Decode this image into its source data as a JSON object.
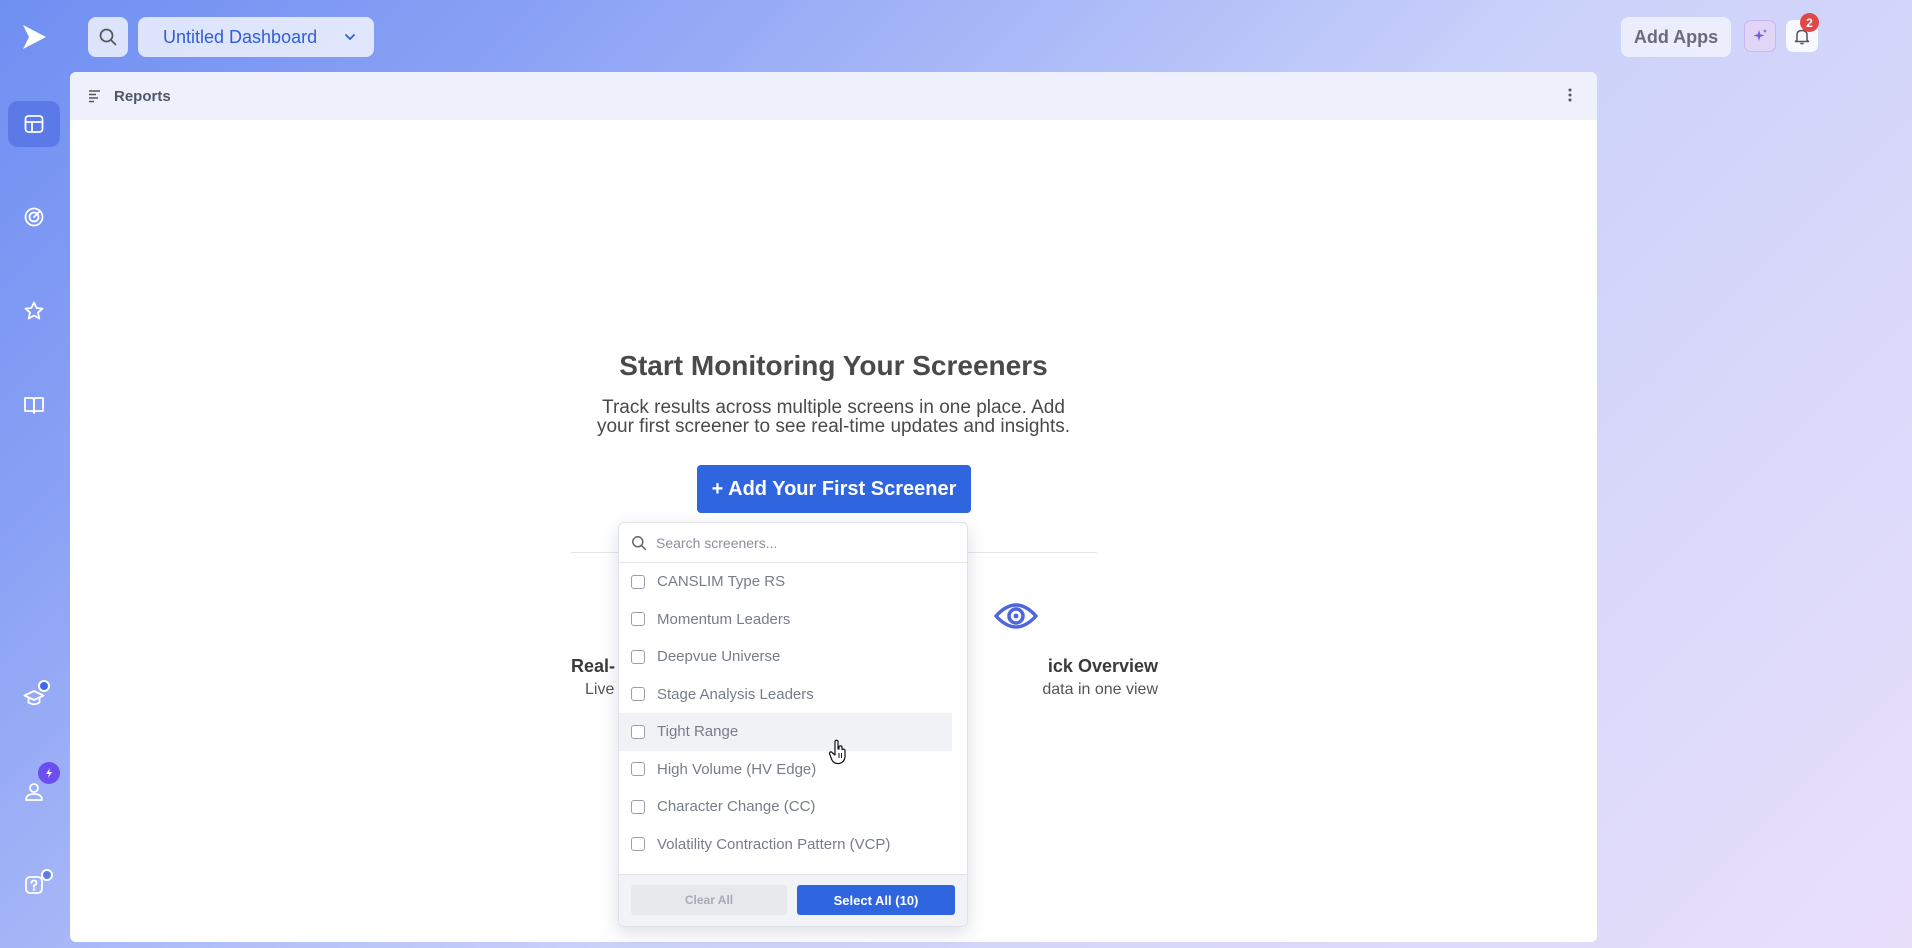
{
  "topbar": {
    "dashboard_name": "Untitled Dashboard",
    "add_apps_label": "Add Apps",
    "notification_count": "2"
  },
  "panel": {
    "title": "Reports"
  },
  "empty_state": {
    "title": "Start Monitoring Your Screeners",
    "description_line1": "Track results across multiple screens in one place. Add",
    "description_line2": "your first screener to see real-time updates and insights.",
    "button_label": "+ Add Your First Screener",
    "features": [
      {
        "title": "Real-",
        "description": "Live"
      },
      {
        "title": "ick Overview",
        "description": "data in one view"
      }
    ]
  },
  "dropdown": {
    "search_placeholder": "Search screeners...",
    "items": [
      {
        "label": "CANSLIM Type RS",
        "checked": false
      },
      {
        "label": "Momentum Leaders",
        "checked": false
      },
      {
        "label": "Deepvue Universe",
        "checked": false
      },
      {
        "label": "Stage Analysis Leaders",
        "checked": false
      },
      {
        "label": "Tight Range",
        "checked": false
      },
      {
        "label": "High Volume (HV Edge)",
        "checked": false
      },
      {
        "label": "Character Change (CC)",
        "checked": false
      },
      {
        "label": "Volatility Contraction Pattern (VCP)",
        "checked": false
      }
    ],
    "clear_label": "Clear All",
    "select_all_label": "Select All (10)"
  },
  "colors": {
    "accent": "#2f66e0",
    "badge": "#e04848",
    "rail_badge": "#6b4ef0"
  }
}
